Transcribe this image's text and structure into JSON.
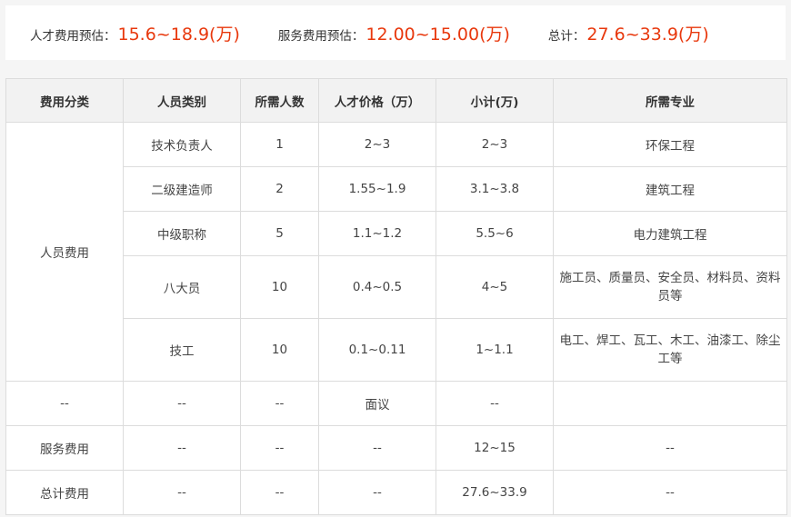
{
  "summary": {
    "talent_label": "人才费用预估：",
    "talent_value": "15.6~18.9(万)",
    "service_label": "服务费用预估：",
    "service_value": "12.00~15.00(万)",
    "total_label": "总计：",
    "total_value": "27.6~33.9(万)"
  },
  "colors": {
    "accent_red": "#e8380d",
    "accent_blue": "#1f8fd2",
    "header_bg": "#f2f2f2",
    "border": "#dcdcdc"
  },
  "table": {
    "headers": [
      "费用分类",
      "人员类别",
      "所需人数",
      "人才价格（万）",
      "小计(万)",
      "所需专业"
    ],
    "personnel_category": "人员费用",
    "personnel_rows": [
      {
        "role": "技术负责人",
        "count": "1",
        "price": "2~3",
        "subtotal": "2~3",
        "major": "环保工程"
      },
      {
        "role": "二级建造师",
        "count": "2",
        "price": "1.55~1.9",
        "subtotal": "3.1~3.8",
        "major": "建筑工程"
      },
      {
        "role": "中级职称",
        "count": "5",
        "price": "1.1~1.2",
        "subtotal": "5.5~6",
        "major": "电力建筑工程"
      },
      {
        "role": "八大员",
        "count": "10",
        "price": "0.4~0.5",
        "subtotal": "4~5",
        "major": "施工员、质量员、安全员、材料员、资料员等"
      },
      {
        "role": "技工",
        "count": "10",
        "price": "0.1~0.11",
        "subtotal": "1~1.1",
        "major": "电工、焊工、瓦工、木工、油漆工、除尘工等"
      }
    ],
    "negotiable_row": {
      "category": "--",
      "role": "--",
      "count": "--",
      "price": "面议",
      "subtotal": "--",
      "major": ""
    },
    "service_row": {
      "category": "服务费用",
      "role": "--",
      "count": "--",
      "price": "--",
      "subtotal": "12~15",
      "major": "--"
    },
    "total_row": {
      "category": "总计费用",
      "role": "--",
      "count": "--",
      "price": "--",
      "subtotal": "27.6~33.9",
      "major": "--"
    }
  }
}
